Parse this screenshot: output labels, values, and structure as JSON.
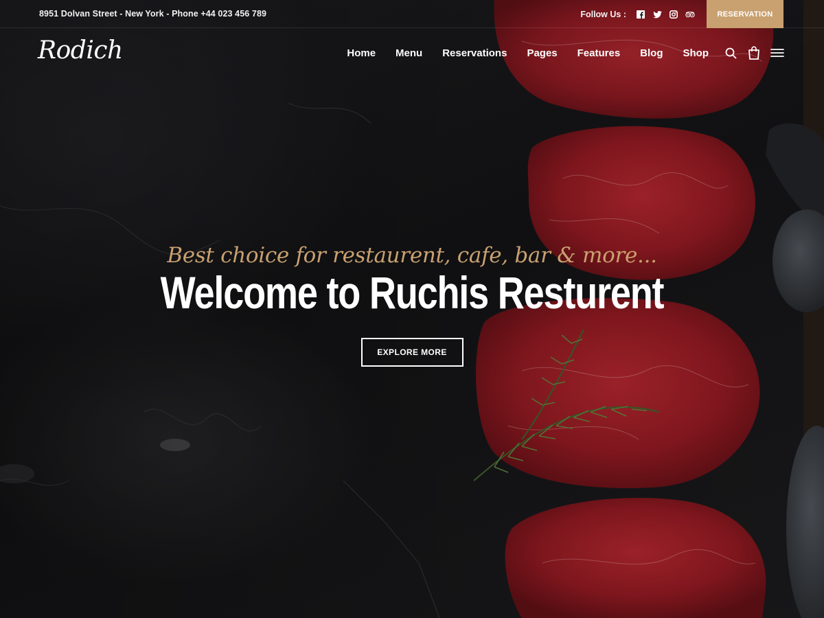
{
  "topbar": {
    "address": "8951 Dolvan Street - New York - Phone +44 023 456 789",
    "follow_label": "Follow Us :",
    "social_icons": [
      "facebook-icon",
      "twitter-icon",
      "instagram-icon",
      "tripadvisor-icon"
    ],
    "reservation_label": "RESERVATION"
  },
  "nav": {
    "logo": "Rodich",
    "links": [
      "Home",
      "Menu",
      "Reservations",
      "Pages",
      "Features",
      "Blog",
      "Shop"
    ],
    "icons": [
      "search-icon",
      "cart-icon",
      "menu-icon"
    ]
  },
  "hero": {
    "tagline": "Best choice for restaurent, cafe, bar & more...",
    "headline": "Welcome to Ruchis Resturent",
    "button_label": "EXPLORE MORE"
  },
  "colors": {
    "accent": "#c9a170",
    "background": "#131315",
    "meat": "#8e1b22"
  }
}
